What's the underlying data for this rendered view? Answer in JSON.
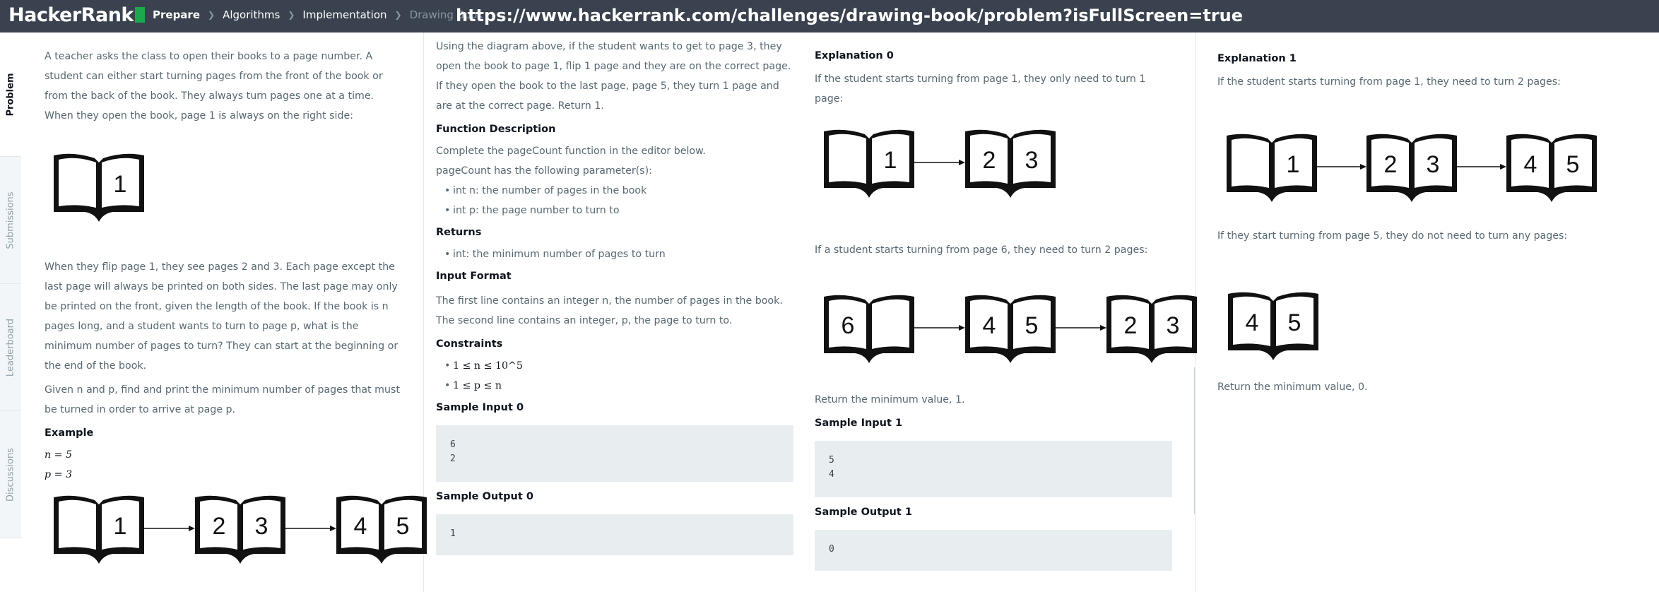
{
  "header": {
    "logo": "HackerRank",
    "breadcrumbs": [
      "Prepare",
      "Algorithms",
      "Implementation",
      "Drawing Book"
    ],
    "url": "https://www.hackerrank.com/challenges/drawing-book/problem?isFullScreen=true"
  },
  "sidebar": {
    "tabs": [
      "Problem",
      "Submissions",
      "Leaderboard",
      "Discussions"
    ]
  },
  "col1": {
    "intro": "A teacher asks the class to open their books to a page number. A student can either start turning pages from the front of the book or from the back of the book. They always turn pages one at a time. When they open the book, page 1 is always on the right side:",
    "flip_para": "When they flip page 1, they see pages 2 and 3. Each page except the last page will always be printed on both sides. The last page may only be printed on the front, given the length of the book. If the book is n pages long, and a student wants to turn to page p, what is the minimum number of pages to turn? They can start at the beginning or the end of the book.",
    "given_para": "Given n and p, find and print the minimum number of pages that must be turned in order to arrive at page p.",
    "example_heading": "Example",
    "n_line": "n = 5",
    "p_line": "p = 3"
  },
  "col2": {
    "diagram_para": "Using the diagram above, if the student wants to get to page 3, they open the book to page 1, flip 1 page and they are on the correct page. If they open the book to the last page, page 5, they turn 1 page and are at the correct page. Return 1.",
    "func_heading": "Function Description",
    "func_line": "Complete the pageCount function in the editor below.",
    "params_line": "pageCount has the following parameter(s):",
    "params": [
      "int n: the number of pages in the book",
      "int p: the page number to turn to"
    ],
    "returns_heading": "Returns",
    "returns": [
      "int: the minimum number of pages to turn"
    ],
    "input_heading": "Input Format",
    "input_line1": "The first line contains an integer n, the number of pages in the book.",
    "input_line2": "The second line contains an integer, p, the page to turn to.",
    "constraints_heading": "Constraints",
    "constraints": [
      "1 ≤ n ≤ 10^5",
      "1 ≤ p ≤ n"
    ],
    "sample_input_heading": "Sample Input 0",
    "sample_input": "6\n2",
    "sample_output_heading": "Sample Output 0",
    "sample_output": "1"
  },
  "col3": {
    "heading": "Explanation 0",
    "line1": "If the student starts turning from page 1, they only need to turn 1 page:",
    "line2": "If a student starts turning from page 6, they need to turn 2 pages:",
    "line3": "Return the minimum value, 1.",
    "sample_input_heading": "Sample Input 1",
    "sample_input": "5\n4",
    "sample_output_heading": "Sample Output 1",
    "sample_output": "0"
  },
  "col4": {
    "heading": "Explanation 1",
    "line1": "If the student starts turning from page 1, they need to turn 2 pages:",
    "line2": "If they start turning from page 5, they do not need to turn any pages:",
    "line3": "Return the minimum value, 0."
  },
  "books": {
    "col1_single": [
      "",
      "1"
    ],
    "col1_seq": [
      [
        "",
        "1"
      ],
      [
        "2",
        "3"
      ],
      [
        "4",
        "5"
      ]
    ],
    "col3_seq_a": [
      [
        "",
        "1"
      ],
      [
        "2",
        "3"
      ]
    ],
    "col3_seq_b": [
      [
        "6",
        ""
      ],
      [
        "4",
        "5"
      ],
      [
        "2",
        "3"
      ]
    ],
    "col4_seq_a": [
      [
        "",
        "1"
      ],
      [
        "2",
        "3"
      ],
      [
        "4",
        "5"
      ]
    ],
    "col4_single": [
      "4",
      "5"
    ]
  },
  "colors": {
    "topbar": "#39424e",
    "brand_green": "#1ba94c",
    "text": "#576871",
    "heading": "#0e141e",
    "code_bg": "#e8eef0"
  }
}
